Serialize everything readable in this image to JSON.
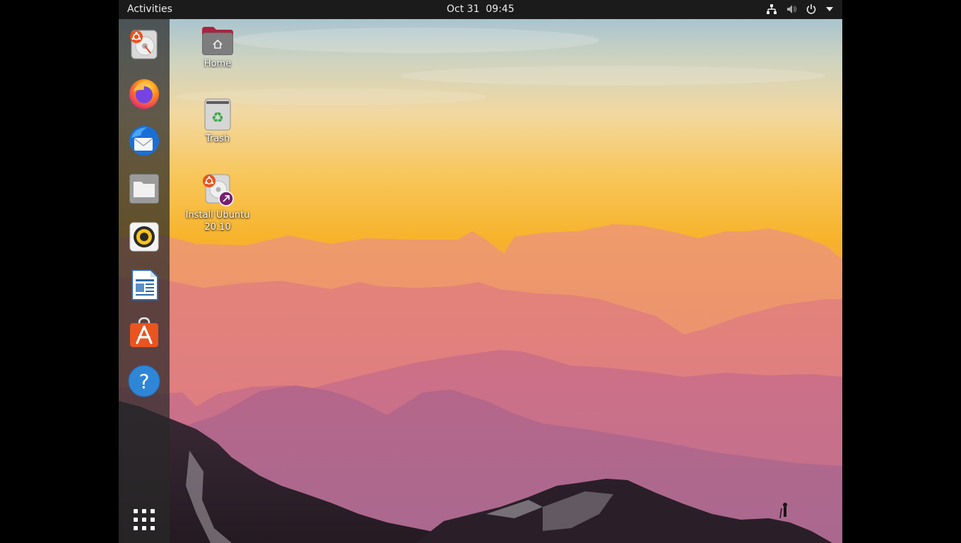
{
  "topbar": {
    "activities_label": "Activities",
    "clock_date": "Oct 31",
    "clock_time": "09:45",
    "tray_icons": [
      "network-wired-icon",
      "volume-muted-icon",
      "power-icon",
      "chevron-down-icon"
    ]
  },
  "dock": {
    "items": [
      {
        "name": "Install Ubuntu",
        "icon": "ubuntu-installer-icon"
      },
      {
        "name": "Firefox",
        "icon": "firefox-icon"
      },
      {
        "name": "Thunderbird",
        "icon": "thunderbird-icon"
      },
      {
        "name": "Files",
        "icon": "files-folder-icon"
      },
      {
        "name": "Rhythmbox",
        "icon": "rhythmbox-speaker-icon"
      },
      {
        "name": "LibreOffice Writer",
        "icon": "libreoffice-writer-icon"
      },
      {
        "name": "Ubuntu Software",
        "icon": "software-center-icon"
      },
      {
        "name": "Help",
        "icon": "help-icon"
      }
    ],
    "show_apps_icon": "app-grid-icon"
  },
  "desktop": {
    "icons": [
      {
        "label": "Home",
        "icon": "home-folder-icon"
      },
      {
        "label": "Trash",
        "icon": "trash-icon"
      },
      {
        "label_line1": "Install Ubuntu",
        "label_line2": "20.10",
        "icon": "install-ubuntu-icon"
      }
    ]
  },
  "colors": {
    "topbar_bg": "#1b1b1b",
    "ubuntu_orange": "#e95420",
    "aubergine": "#77216f",
    "sky_top": "#a9c5cf",
    "sunset_yellow": "#f7b32b"
  }
}
